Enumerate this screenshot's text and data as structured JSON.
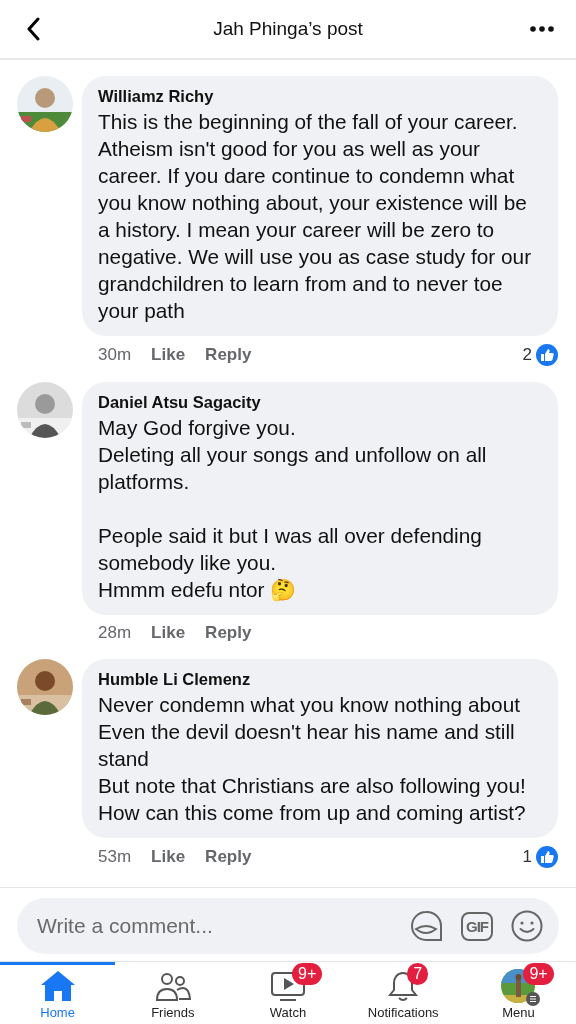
{
  "header": {
    "title": "Jah Phinga’s post"
  },
  "comments": [
    {
      "author": "Williamz Richy",
      "text": "This is the beginning of the fall of your career. Atheism isn't good for you as well as your career. If you dare continue to condemn what you know nothing about, your existence will be a history. I mean your career will be zero to negative. We will use you  as case study for our grandchildren to learn from and to never toe your path",
      "time": "30m",
      "like": "Like",
      "reply": "Reply",
      "reactions": "2"
    },
    {
      "author": "Daniel Atsu Sagacity",
      "text": "May God forgive you.\nDeleting all your songs and unfollow on all platforms.\n\nPeople said it but I was all over defending somebody like you.\nHmmm edefu ntor 🤔",
      "time": "28m",
      "like": "Like",
      "reply": "Reply"
    },
    {
      "author": "Humble Li Clemenz",
      "text": "Never condemn what you know nothing about\nEven the devil doesn't hear his name and still stand\nBut note that Christians are also following you!\nHow can this come from up and coming artist?",
      "time": "53m",
      "like": "Like",
      "reply": "Reply",
      "reactions": "1"
    }
  ],
  "composer": {
    "placeholder": "Write a comment...",
    "gif": "GIF"
  },
  "nav": [
    {
      "kind": "home",
      "label": "Home",
      "selected": true
    },
    {
      "kind": "friends",
      "label": "Friends",
      "selected": false
    },
    {
      "kind": "watch",
      "label": "Watch",
      "selected": false,
      "badge": "9+"
    },
    {
      "kind": "notifications",
      "label": "Notifications",
      "selected": false,
      "badge": "7"
    },
    {
      "kind": "menu",
      "label": "Menu",
      "selected": false,
      "badge": "9+"
    }
  ]
}
